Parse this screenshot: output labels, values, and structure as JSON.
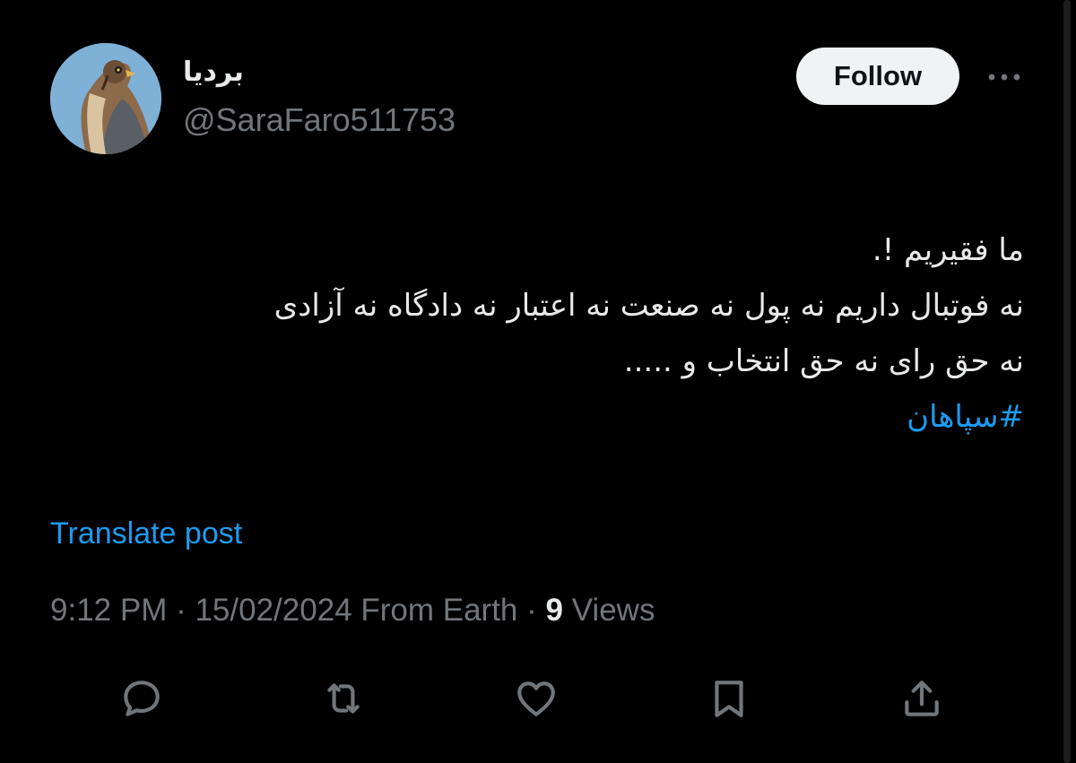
{
  "author": {
    "display_name": "برديا",
    "handle": "@SaraFaro511753",
    "avatar_icon": "falcon-avatar"
  },
  "header": {
    "follow_label": "Follow",
    "more_icon": "more-horizontal-icon"
  },
  "tweet": {
    "lines": [
      "ما فقیریم !.",
      "نه فوتبال داریم نه پول نه صنعت نه اعتبار نه دادگاه نه آزادی",
      "نه حق رای نه حق انتخاب و ....."
    ],
    "hashtag": "#سپاهان"
  },
  "translate": {
    "label": "Translate post"
  },
  "meta": {
    "time": "9:12 PM",
    "separator": " · ",
    "date": "15/02/2024",
    "source": " From Earth",
    "separator2": " · ",
    "views_count": "9",
    "views_label": " Views"
  },
  "actions": [
    {
      "name": "reply",
      "icon": "reply-icon"
    },
    {
      "name": "repost",
      "icon": "repost-icon"
    },
    {
      "name": "like",
      "icon": "like-icon"
    },
    {
      "name": "bookmark",
      "icon": "bookmark-icon"
    },
    {
      "name": "share",
      "icon": "share-icon"
    }
  ],
  "colors": {
    "background": "#000000",
    "text": "#e7e9ea",
    "muted": "#71767b",
    "accent": "#1d9bf0",
    "follow_bg": "#eff3f4"
  }
}
